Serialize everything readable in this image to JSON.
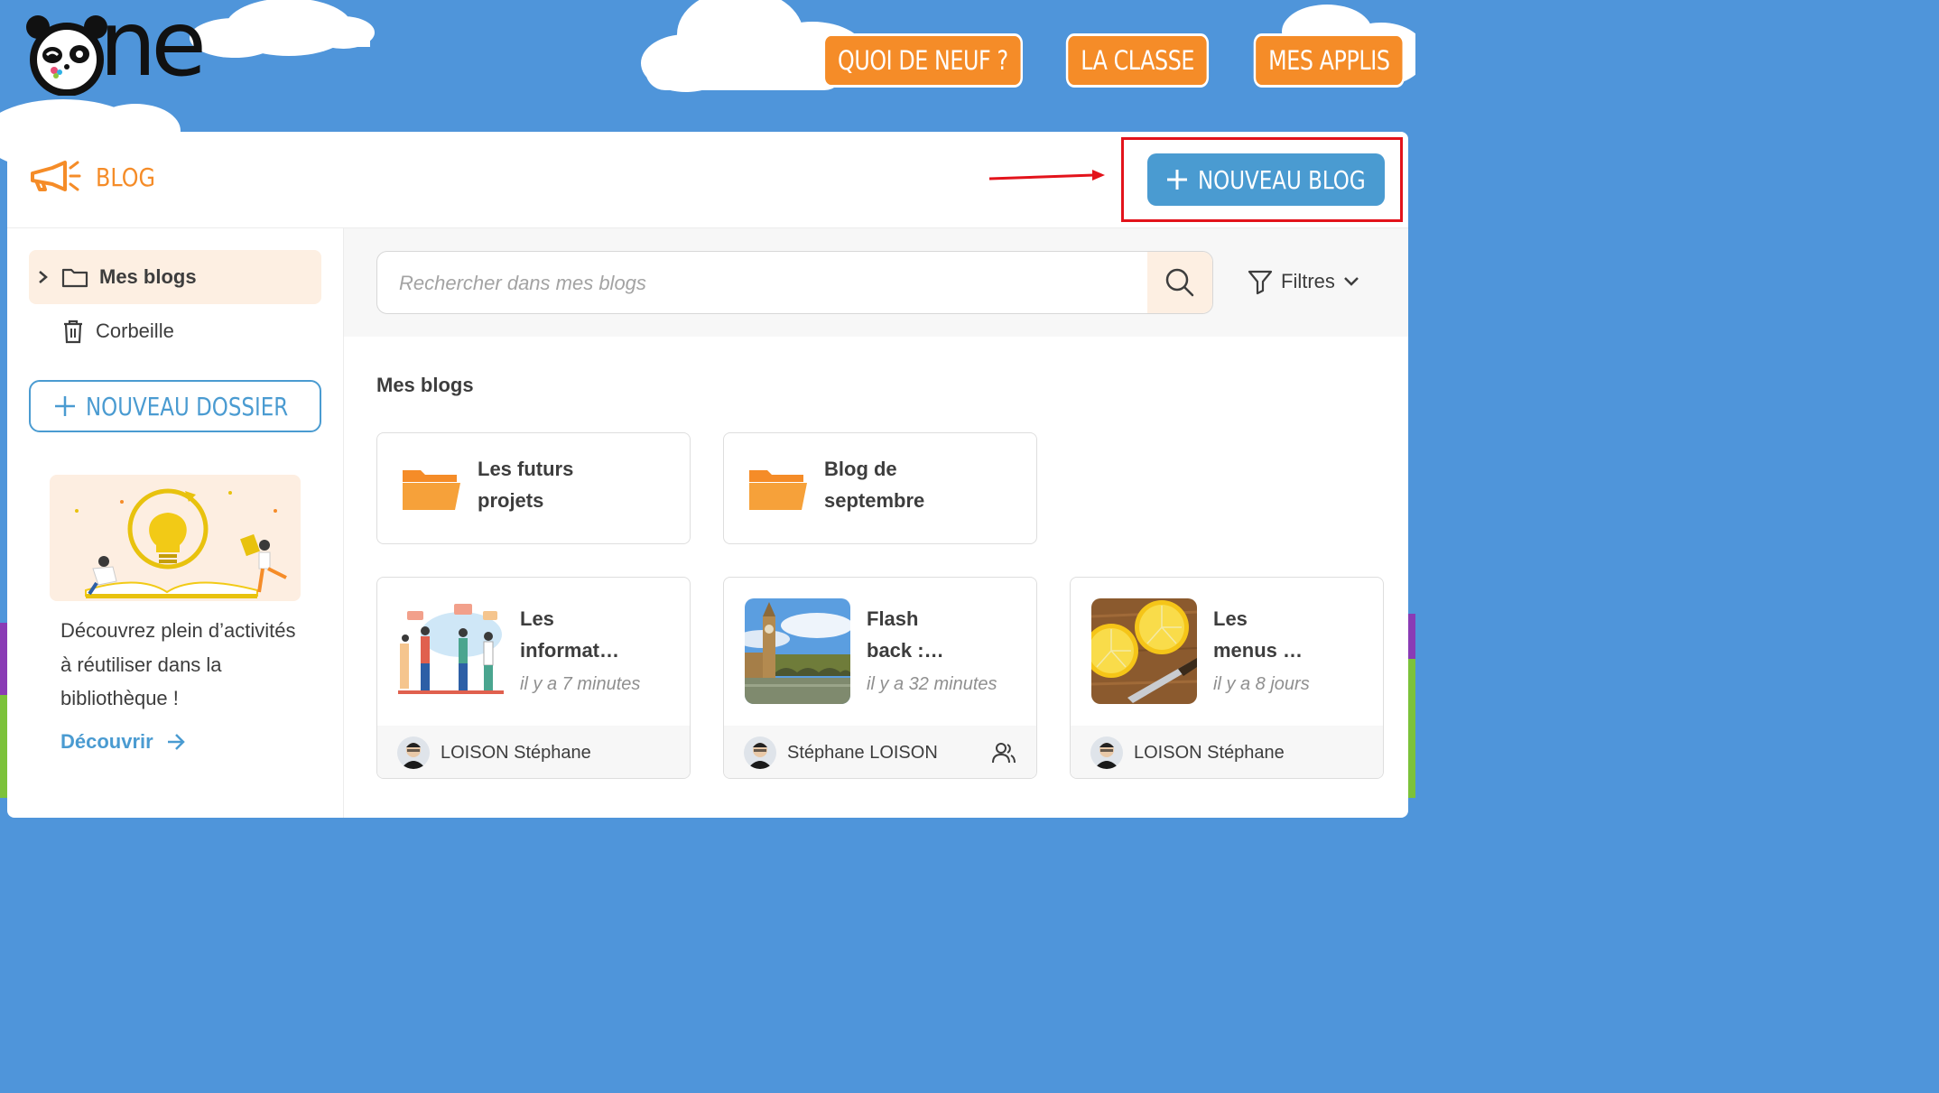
{
  "app": {
    "name": "ne",
    "section_title": "BLOG"
  },
  "topnav": [
    {
      "label": "QUOI DE NEUF ?"
    },
    {
      "label": "LA CLASSE"
    },
    {
      "label": "MES APPLIS"
    }
  ],
  "header": {
    "new_blog_label": "NOUVEAU BLOG"
  },
  "sidebar": {
    "items": [
      {
        "label": "Mes blogs",
        "icon": "folder-icon",
        "active": true
      },
      {
        "label": "Corbeille",
        "icon": "trash-icon",
        "active": false
      }
    ],
    "new_folder_label": "NOUVEAU DOSSIER",
    "promo": {
      "text": "Découvrez plein d’activités à réutiliser dans la bibliothèque !",
      "link": "Découvrir"
    }
  },
  "search": {
    "placeholder": "Rechercher dans mes blogs",
    "value": ""
  },
  "filters": {
    "label": "Filtres"
  },
  "main": {
    "section_title": "Mes blogs",
    "folders": [
      {
        "line1": "Les futurs",
        "line2": "projets"
      },
      {
        "line1": "Blog de",
        "line2": "septembre"
      }
    ],
    "blogs": [
      {
        "line1": "Les",
        "line2": "informat…",
        "time": "il y a 7 minutes",
        "author": "LOISON Stéphane",
        "shared": false,
        "thumb": "people-illustration"
      },
      {
        "line1": "Flash",
        "line2": "back :…",
        "time": "il y a 32 minutes",
        "author": "Stéphane LOISON",
        "shared": true,
        "thumb": "london-photo"
      },
      {
        "line1": "Les",
        "line2": "menus …",
        "time": "il y a 8 jours",
        "author": "LOISON Stéphane",
        "shared": false,
        "thumb": "lemon-photo"
      }
    ]
  },
  "colors": {
    "accent_orange": "#f58c28",
    "accent_blue": "#4a9bd1",
    "sky": "#4f95da",
    "annotation_red": "#e3131b"
  }
}
